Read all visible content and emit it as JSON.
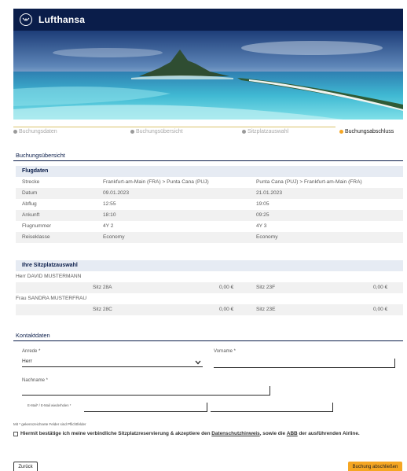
{
  "header": {
    "brand": "Lufthansa"
  },
  "progress": {
    "steps": [
      {
        "label": "Buchungsdaten",
        "active": false
      },
      {
        "label": "Buchungsübersicht",
        "active": false
      },
      {
        "label": "Sitzplatzauswahl",
        "active": false
      },
      {
        "label": "Buchungsabschluss",
        "active": true
      }
    ]
  },
  "overview": {
    "title": "Buchungsübersicht"
  },
  "flight": {
    "header": "Flugdaten",
    "rows": [
      {
        "label": "Strecke",
        "out": "Frankfurt-am-Main (FRA) > Punta Cana (PUJ)",
        "ret": "Punta Cana (PUJ) > Frankfurt-am-Main (FRA)"
      },
      {
        "label": "Datum",
        "out": "09.01.2023",
        "ret": "21.01.2023"
      },
      {
        "label": "Abflug",
        "out": "12:55",
        "ret": "19:05"
      },
      {
        "label": "Ankunft",
        "out": "18:10",
        "ret": "09:25"
      },
      {
        "label": "Flugnummer",
        "out": "4Y 2",
        "ret": "4Y 3"
      },
      {
        "label": "Reiseklasse",
        "out": "Economy",
        "ret": "Economy"
      }
    ]
  },
  "seats": {
    "header": "Ihre Sitzplatzauswahl",
    "passengers": [
      {
        "name": "Herr DAVID MUSTERMANN",
        "seat_out": "Sitz 28A",
        "price_out": "0,00 €",
        "seat_ret": "Sitz 23F",
        "price_ret": "0,00 €"
      },
      {
        "name": "Frau SANDRA MUSTERFRAU",
        "seat_out": "Sitz 28C",
        "price_out": "0,00 €",
        "seat_ret": "Sitz 23E",
        "price_ret": "0,00 €"
      }
    ]
  },
  "contact": {
    "title": "Kontaktdaten",
    "anrede_label": "Anrede *",
    "anrede_value": "Herr",
    "vorname_label": "Vorname *",
    "nachname_label": "Nachname *",
    "email_label": "E-Mail* / E-Mail wiederholen *"
  },
  "form": {
    "mandatory_note": "Mit * gekennzeichnete Felder sind Pflichtfelder",
    "consent_prefix": "Hiermit bestätige ich meine verbindliche Sitzplatzreservierung & akzeptiere den",
    "consent_link1": "Datenschutzhinweis",
    "consent_mid": ", sowie die",
    "consent_link2": "ABB",
    "consent_suffix": "der ausführenden Airline."
  },
  "buttons": {
    "back": "Zurück",
    "finish": "Buchung abschließen"
  },
  "colors": {
    "navy": "#0a1d4a",
    "accent": "#f5a623"
  }
}
